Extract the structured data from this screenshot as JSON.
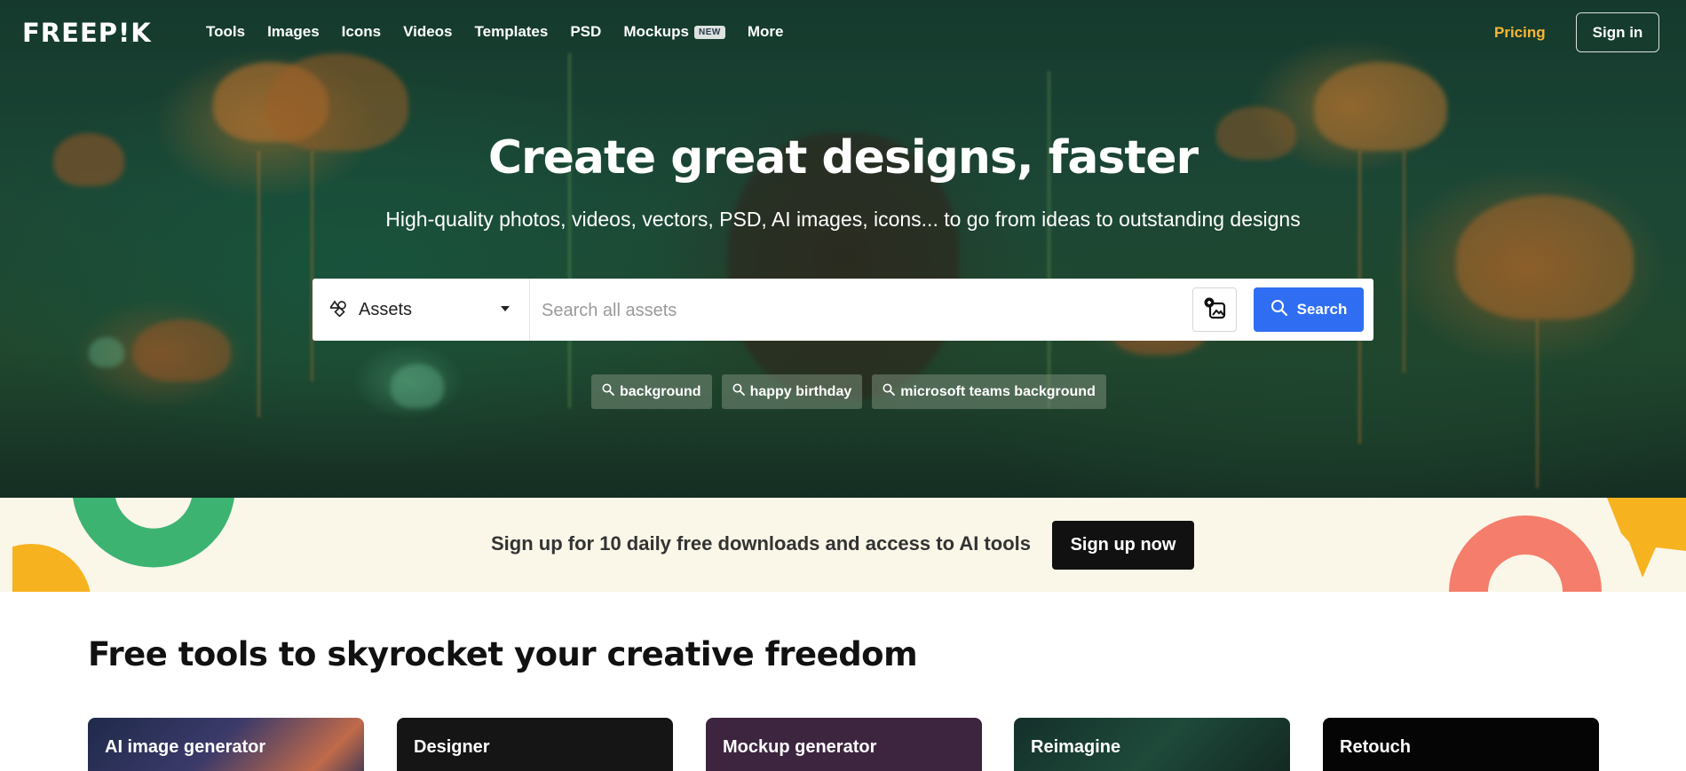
{
  "brand": {
    "logo": "FREEP!K"
  },
  "nav": {
    "items": [
      {
        "label": "Tools"
      },
      {
        "label": "Images"
      },
      {
        "label": "Icons"
      },
      {
        "label": "Videos"
      },
      {
        "label": "Templates"
      },
      {
        "label": "PSD"
      },
      {
        "label": "Mockups",
        "badge": "NEW"
      },
      {
        "label": "More"
      }
    ],
    "pricing": "Pricing",
    "signin": "Sign in"
  },
  "hero": {
    "headline": "Create great designs, faster",
    "subline": "High-quality photos, videos, vectors, PSD, AI images, icons... to go from ideas to outstanding designs",
    "search": {
      "asset_type": "Assets",
      "placeholder": "Search all assets",
      "button": "Search"
    },
    "suggestions": [
      "background",
      "happy birthday",
      "microsoft teams background"
    ]
  },
  "banner": {
    "text": "Sign up for 10 daily free downloads and access to AI tools",
    "button": "Sign up now"
  },
  "tools": {
    "title": "Free tools to skyrocket your creative freedom",
    "cards": [
      {
        "label": "AI image generator"
      },
      {
        "label": "Designer"
      },
      {
        "label": "Mockup generator"
      },
      {
        "label": "Reimagine"
      },
      {
        "label": "Retouch"
      }
    ]
  },
  "colors": {
    "accent_blue": "#2f6ef2",
    "pricing_yellow": "#f7b733",
    "banner_bg": "#faf6e8"
  }
}
